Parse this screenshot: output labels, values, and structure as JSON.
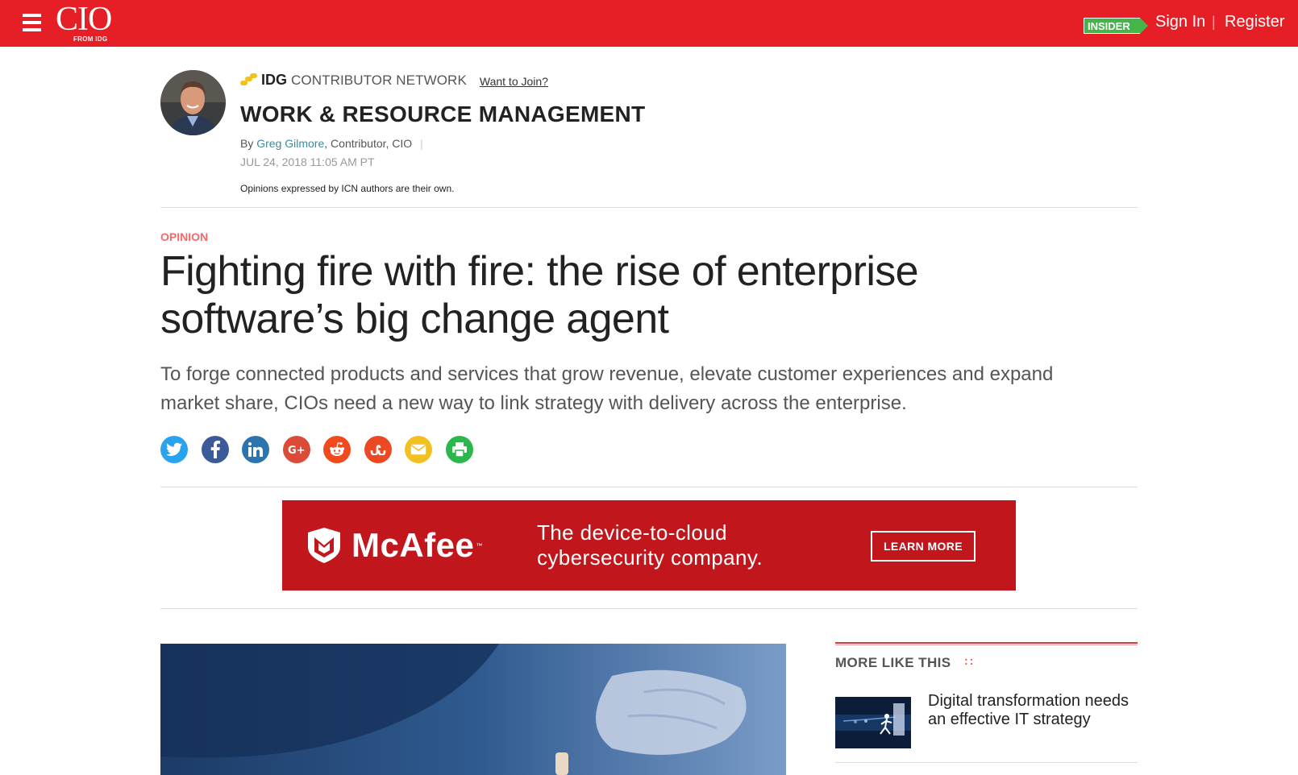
{
  "header": {
    "logo_text": "CIO",
    "logo_sub": "FROM IDG",
    "insider_label": "INSIDER",
    "signin_label": "Sign In",
    "separator": "|",
    "register_label": "Register",
    "bar_color": "#e61e25"
  },
  "author_block": {
    "network_brand": "IDG",
    "network_label": "CONTRIBUTOR NETWORK",
    "join_label": "Want to Join?",
    "blog_title": "WORK & RESOURCE MANAGEMENT",
    "by_label": "By",
    "author_name": "Greg Gilmore",
    "author_role": ", Contributor, CIO",
    "byline_pipe": "|",
    "date": "JUL 24, 2018 11:05 AM PT",
    "disclaimer": "Opinions expressed by ICN authors are their own."
  },
  "article": {
    "kicker": "OPINION",
    "headline": "Fighting fire with fire: the rise of enterprise software’s big change agent",
    "dek": "To forge connected products and services that grow revenue, elevate customer experiences and expand market share, CIOs need a new way to link strategy with delivery across the enterprise."
  },
  "share": [
    {
      "name": "twitter-icon",
      "color": "#2aa3ef",
      "glyph": ""
    },
    {
      "name": "facebook-icon",
      "color": "#3b5a9a",
      "glyph": ""
    },
    {
      "name": "linkedin-icon",
      "color": "#2d73ad",
      "glyph": ""
    },
    {
      "name": "google-plus-icon",
      "color": "#dc4a38",
      "glyph": ""
    },
    {
      "name": "reddit-icon",
      "color": "#f04a1d",
      "glyph": ""
    },
    {
      "name": "stumbleupon-icon",
      "color": "#eb4924",
      "glyph": ""
    },
    {
      "name": "email-icon",
      "color": "#f1c122",
      "glyph": ""
    },
    {
      "name": "print-icon",
      "color": "#2bb74b",
      "glyph": ""
    }
  ],
  "ad": {
    "brand": "McAfee",
    "tm": "™",
    "tagline_line1": "The device-to-cloud",
    "tagline_line2": "cybersecurity company.",
    "cta": "LEARN MORE",
    "bg_color": "#c0161c"
  },
  "more_like_this": {
    "title": "MORE LIKE THIS",
    "dots": "::",
    "items": [
      {
        "title": "Digital transformation needs an effective IT strategy"
      }
    ]
  }
}
